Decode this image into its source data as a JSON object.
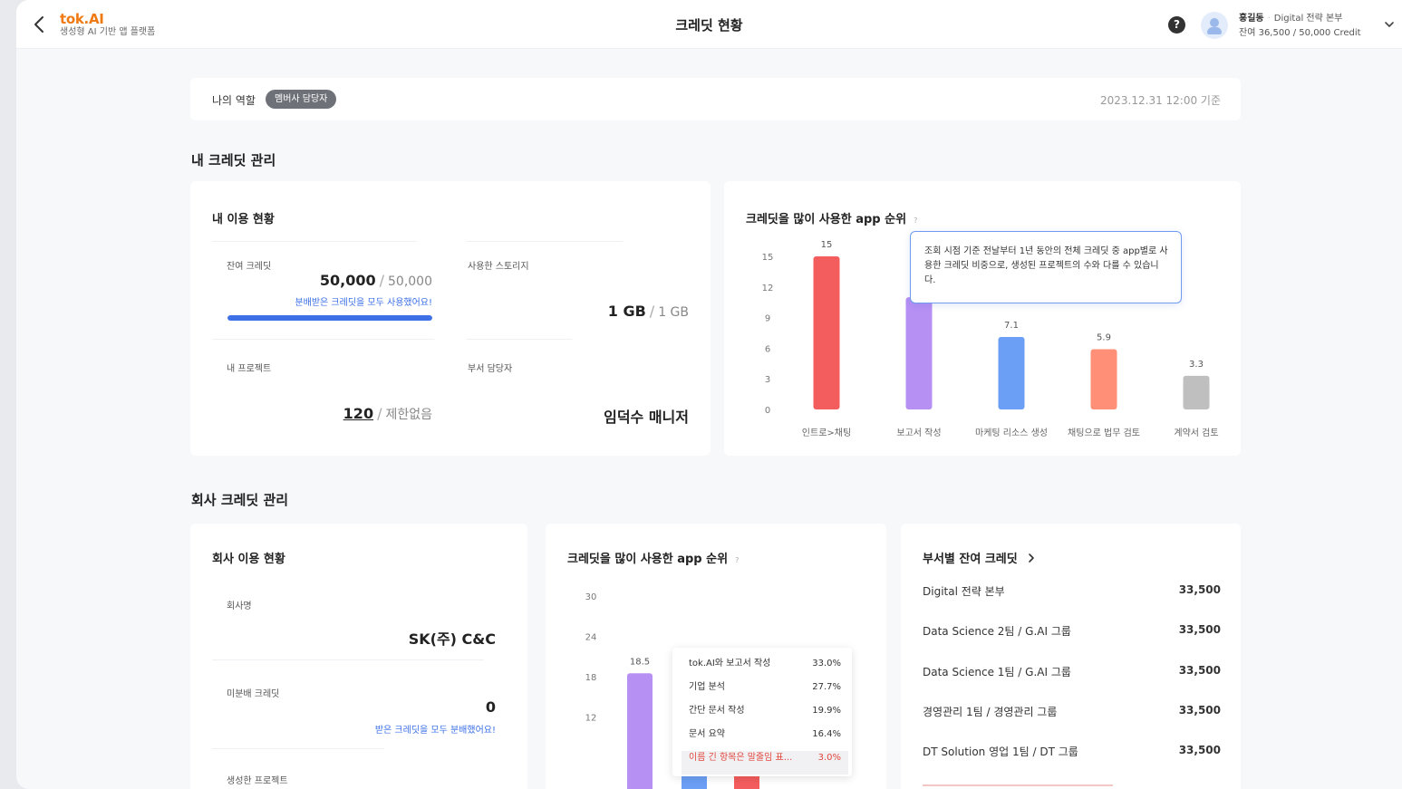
{
  "header": {
    "brand": "tok.AI",
    "tagline": "생성형 AI 기반 앱 플랫폼",
    "title": "크레딧 현황",
    "help": "?",
    "user_name": "홍길동",
    "user_dept": "Digital 전략 본부",
    "user_credit": "잔여 36,500 / 50,000 Credit"
  },
  "role": {
    "label": "나의 역할",
    "badge": "멤버사 담당자",
    "as_of": "2023.12.31 12:00 기준"
  },
  "my_section": {
    "title": "내 크레딧 관리",
    "usage_card": {
      "title": "내 이용 현황",
      "remaining": {
        "label": "잔여 크레딧",
        "value": "50,000",
        "total": "50,000",
        "note": "분배받은 크레딧을 모두 사용했어요!",
        "progress": 1.0
      },
      "storage": {
        "label": "사용한 스토리지",
        "value": "1 GB",
        "total": "1 GB"
      },
      "projects": {
        "label": "내 프로젝트",
        "value": "120",
        "total": "제한없음"
      },
      "manager": {
        "label": "부서 담당자",
        "value": "임덕수 매니저"
      }
    },
    "chart_card": {
      "title": "크레딧을 많이 사용한 app 순위",
      "help": "?",
      "tooltip": "조회 시점 기준 전날부터 1년 동안의 전체 크레딧 중 app별로 사용한 크레딧 비중으로, 생성된 프로젝트의 수와 다를 수 있습니다."
    }
  },
  "company_section": {
    "title": "회사 크레딧 관리",
    "usage_card": {
      "title": "회사 이용 현황",
      "company": {
        "label": "회사명",
        "value": "SK(주) C&C"
      },
      "unallocated": {
        "label": "미분배 크레딧",
        "value": "0",
        "note": "받은 크레딧을 모두 분배했어요!"
      },
      "projects": {
        "label": "생성한 프로젝트"
      }
    },
    "chart_card": {
      "title": "크레딧을 많이 사용한 app 순위",
      "help": "?",
      "legend": [
        {
          "name": "tok.AI와 보고서 작성",
          "pct": "33.0%"
        },
        {
          "name": "기업 분석",
          "pct": "27.7%"
        },
        {
          "name": "간단 문서 작성",
          "pct": "19.9%"
        },
        {
          "name": "문서 요약",
          "pct": "16.4%"
        },
        {
          "name": "이름 긴 항목은 말줄임 표...",
          "pct": "3.0%"
        }
      ]
    },
    "dept_card": {
      "title": "부서별 잔여 크레딧",
      "rows": [
        {
          "name": "Digital 전략 본부",
          "value": "33,500"
        },
        {
          "name": "Data Science 2팀 / G.AI 그룹",
          "value": "33,500"
        },
        {
          "name": "Data Science 1팀 / G.AI 그룹",
          "value": "33,500"
        },
        {
          "name": "경영관리 1팀 / 경영관리 그룹",
          "value": "33,500"
        },
        {
          "name": "DT Solution 영업 1팀 / DT 그룹",
          "value": "33,500"
        }
      ]
    }
  },
  "chart_data": [
    {
      "type": "bar",
      "title": "크레딧을 많이 사용한 app 순위",
      "categories": [
        "인트로>채팅",
        "보고서 작성",
        "마케팅 리소스 생성",
        "채팅으로 법무 검토",
        "계약서 검토"
      ],
      "values": [
        15,
        11.0,
        7.1,
        5.9,
        3.3
      ],
      "value_labels": [
        "15",
        "11.0",
        "7.1",
        "5.9",
        "3.3"
      ],
      "colors": [
        "#f45d5d",
        "#b690f3",
        "#6b9ff5",
        "#ff8f76",
        "#bfbfbf"
      ],
      "yticks": [
        0,
        3,
        6,
        9,
        12,
        15
      ],
      "ylim": [
        0,
        15
      ]
    },
    {
      "type": "bar",
      "title": "크레딧을 많이 사용한 app 순위",
      "categories": [
        "tok.AI와 보고서 작성",
        "기업 분석",
        "간단 문서 작성"
      ],
      "values": [
        18.5,
        12,
        9
      ],
      "value_labels": [
        "18.5",
        "12",
        ""
      ],
      "colors": [
        "#b690f3",
        "#6b9ff5",
        "#f45d5d"
      ],
      "yticks": [
        12,
        18,
        24,
        30
      ],
      "ylim": [
        6,
        30
      ]
    }
  ]
}
